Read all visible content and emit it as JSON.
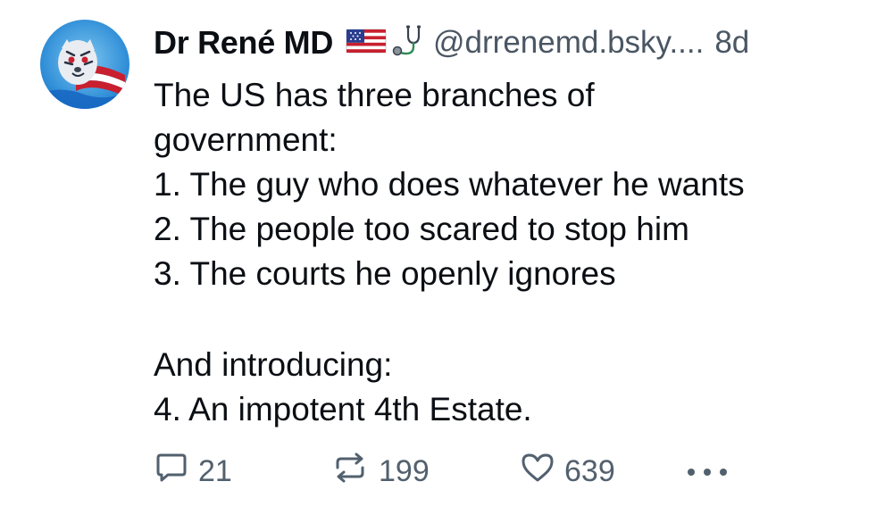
{
  "post": {
    "display_name": "Dr René MD",
    "handle": "@drrenemd.bsky....",
    "time": "8d",
    "avatar_icon": "tiger-flag-avatar",
    "badges": [
      "us-flag-icon",
      "stethoscope-icon"
    ],
    "lines": [
      "The US has three branches of",
      "government:",
      "1. The guy who does whatever he wants",
      "2. The people too scared to stop him",
      "3. The courts he openly ignores",
      "",
      "And introducing:",
      "4.  An impotent 4th Estate."
    ]
  },
  "actions": {
    "reply_count": "21",
    "repost_count": "199",
    "like_count": "639",
    "more_icon": "ellipsis-icon"
  },
  "colors": {
    "text": "#0b0f14",
    "muted": "#4a5663",
    "icon": "#52606e"
  }
}
